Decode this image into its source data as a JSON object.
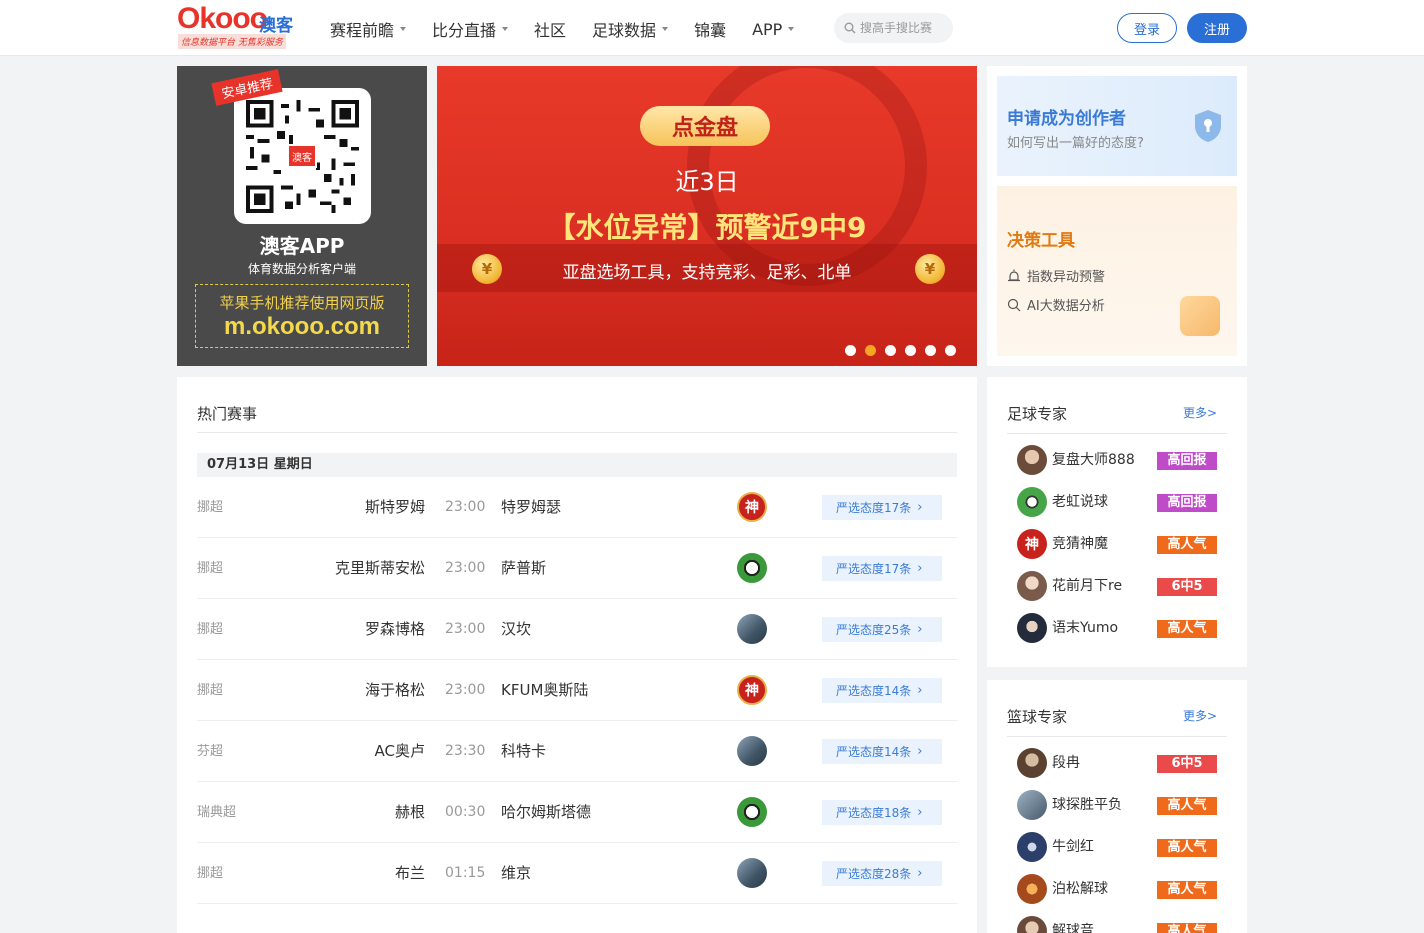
{
  "header": {
    "logo_main": "Okooo",
    "logo_cn": "澳客",
    "logo_sub": "信息数据平台 无售彩服务",
    "nav": [
      {
        "label": "赛程前瞻",
        "dropdown": true
      },
      {
        "label": "比分直播",
        "dropdown": true
      },
      {
        "label": "社区",
        "dropdown": false
      },
      {
        "label": "足球数据",
        "dropdown": true
      },
      {
        "label": "锦囊",
        "dropdown": false
      },
      {
        "label": "APP",
        "dropdown": true
      }
    ],
    "search_placeholder": "搜高手搜比赛",
    "login_label": "登录",
    "register_label": "注册"
  },
  "app_card": {
    "badge": "安卓推荐",
    "qr_center": "澳客",
    "title": "澳客APP",
    "subtitle": "体育数据分析客户端",
    "box_line1": "苹果手机推荐使用网页版",
    "box_line2": "m.okooo.com"
  },
  "banner": {
    "pill": "点金盘",
    "line1": "近3日",
    "line2": "【水位异常】预警近9中9",
    "line3": "亚盘选场工具，支持竞彩、足彩、北单",
    "coin_symbol": "¥",
    "slide_count": 6,
    "active_slide": 2
  },
  "right_promo": {
    "creator_title": "申请成为创作者",
    "creator_sub": "如何写出一篇好的态度?",
    "tools_title": "决策工具",
    "tools_items": [
      "指数异动预警",
      "AI大数据分析"
    ]
  },
  "matches": {
    "title": "热门赛事",
    "date": "07月13日 星期日",
    "rows": [
      {
        "league": "挪超",
        "home": "斯特罗姆",
        "time": "23:00",
        "away": "特罗姆瑟",
        "avatar": "shen",
        "pick": "严选态度17条"
      },
      {
        "league": "挪超",
        "home": "克里斯蒂安松",
        "time": "23:00",
        "away": "萨普斯",
        "avatar": "ball",
        "pick": "严选态度17条"
      },
      {
        "league": "挪超",
        "home": "罗森博格",
        "time": "23:00",
        "away": "汉坎",
        "avatar": "photo",
        "pick": "严选态度25条"
      },
      {
        "league": "挪超",
        "home": "海于格松",
        "time": "23:00",
        "away": "KFUM奥斯陆",
        "avatar": "shen",
        "pick": "严选态度14条"
      },
      {
        "league": "芬超",
        "home": "AC奥卢",
        "time": "23:30",
        "away": "科特卡",
        "avatar": "photo",
        "pick": "严选态度14条"
      },
      {
        "league": "瑞典超",
        "home": "赫根",
        "time": "00:30",
        "away": "哈尔姆斯塔德",
        "avatar": "ball",
        "pick": "严选态度18条"
      },
      {
        "league": "挪超",
        "home": "布兰",
        "time": "01:15",
        "away": "维京",
        "avatar": "photo",
        "pick": "严选态度28条"
      }
    ],
    "shen_label": "神"
  },
  "football_experts": {
    "title": "足球专家",
    "more": "更多>",
    "list": [
      {
        "name": "复盘大师888",
        "tag": "高回报",
        "tag_color": "purple",
        "av": "a"
      },
      {
        "name": "老虹说球",
        "tag": "高回报",
        "tag_color": "purple",
        "av": "b"
      },
      {
        "name": "竞猜神魔",
        "tag": "高人气",
        "tag_color": "orange",
        "av": "c"
      },
      {
        "name": "花前月下re",
        "tag": "6中5",
        "tag_color": "red",
        "av": "d"
      },
      {
        "name": "语末Yumo",
        "tag": "高人气",
        "tag_color": "orange",
        "av": "e"
      }
    ]
  },
  "basketball_experts": {
    "title": "篮球专家",
    "more": "更多>",
    "list": [
      {
        "name": "段冉",
        "tag": "6中5",
        "tag_color": "red",
        "av": "f"
      },
      {
        "name": "球探胜平负",
        "tag": "高人气",
        "tag_color": "orange",
        "av": "g"
      },
      {
        "name": "牛剑红",
        "tag": "高人气",
        "tag_color": "orange",
        "av": "h"
      },
      {
        "name": "泊松解球",
        "tag": "高人气",
        "tag_color": "orange",
        "av": "i"
      },
      {
        "name": "解球音",
        "tag": "高人气",
        "tag_color": "orange",
        "av": "j"
      }
    ]
  },
  "colors": {
    "brand_red": "#e8332a",
    "brand_blue": "#2a6fd6",
    "tag_purple": "#c04bc9",
    "tag_orange": "#f06a1c",
    "tag_red": "#ea4a4a"
  }
}
